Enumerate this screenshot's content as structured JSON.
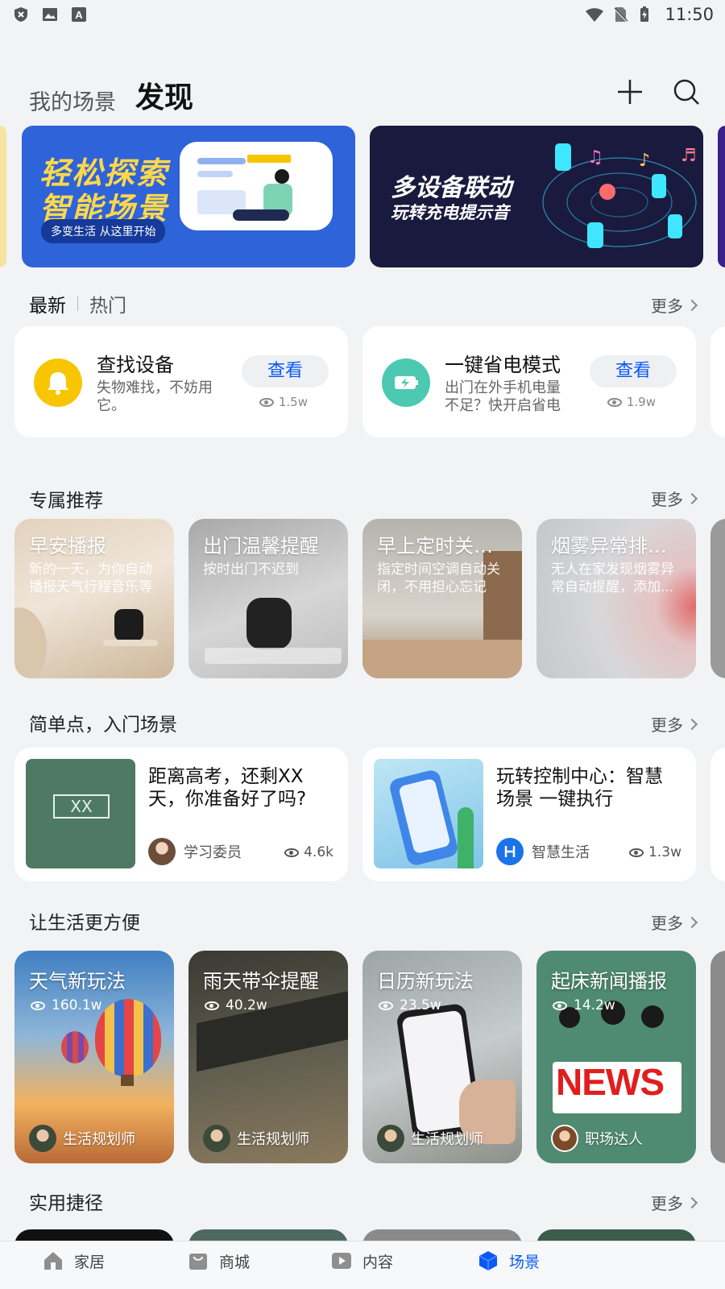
{
  "status_bar": {
    "time": "11:50"
  },
  "header": {
    "tab_my": "我的场景",
    "tab_discover": "发现"
  },
  "banners": [
    {
      "line1": "轻松探索",
      "line2": "智能场景",
      "tag": "多变生活 从这里开始"
    },
    {
      "line1": "多设备联动",
      "line2": "玩转充电提示音"
    }
  ],
  "latest": {
    "tab_latest": "最新",
    "tab_hot": "热门",
    "more": "更多",
    "cards": [
      {
        "title": "查找设备",
        "desc": "失物难找，不妨用它。",
        "button": "查看",
        "views": "1.5w"
      },
      {
        "title": "一键省电模式",
        "desc": "出门在外手机电量不足？快开启省电模...",
        "button": "查看",
        "views": "1.9w"
      }
    ]
  },
  "exclusive": {
    "title": "专属推荐",
    "more": "更多",
    "tiles": [
      {
        "title": "早安播报",
        "desc": "新的一天，为你自动播报天气行程音乐等"
      },
      {
        "title": "出门温馨提醒",
        "desc": "按时出门不迟到"
      },
      {
        "title": "早上定时关空...",
        "desc": "指定时间空调自动关闭，不用担心忘记"
      },
      {
        "title": "烟雾异常排烟...",
        "desc": "无人在家发现烟雾异常自动提醒，添加..."
      }
    ]
  },
  "beginner": {
    "title": "简单点，入门场景",
    "more": "更多",
    "cards": [
      {
        "title": "距离高考，还剩XX天，你准备好了吗?",
        "author": "学习委员",
        "views": "4.6k",
        "thumb_text": "XX"
      },
      {
        "title": "玩转控制中心：智慧场景 一键执行",
        "author": "智慧生活",
        "views": "1.3w"
      }
    ]
  },
  "convenient": {
    "title": "让生活更方便",
    "more": "更多",
    "tiles": [
      {
        "title": "天气新玩法",
        "views": "160.1w",
        "author": "生活规划师"
      },
      {
        "title": "雨天带伞提醒",
        "views": "40.2w",
        "author": "生活规划师"
      },
      {
        "title": "日历新玩法",
        "views": "23.5w",
        "author": "生活规划师"
      },
      {
        "title": "起床新闻播报",
        "views": "14.2w",
        "author": "职场达人",
        "badge": "NEWS"
      }
    ]
  },
  "shortcuts": {
    "title": "实用捷径",
    "more": "更多"
  },
  "bottom_nav": [
    {
      "label": "家居"
    },
    {
      "label": "商城"
    },
    {
      "label": "内容"
    },
    {
      "label": "场景"
    }
  ],
  "colors": {
    "accent": "#0a59f7",
    "bell": "#f7c600",
    "battery": "#4cc9b0"
  }
}
